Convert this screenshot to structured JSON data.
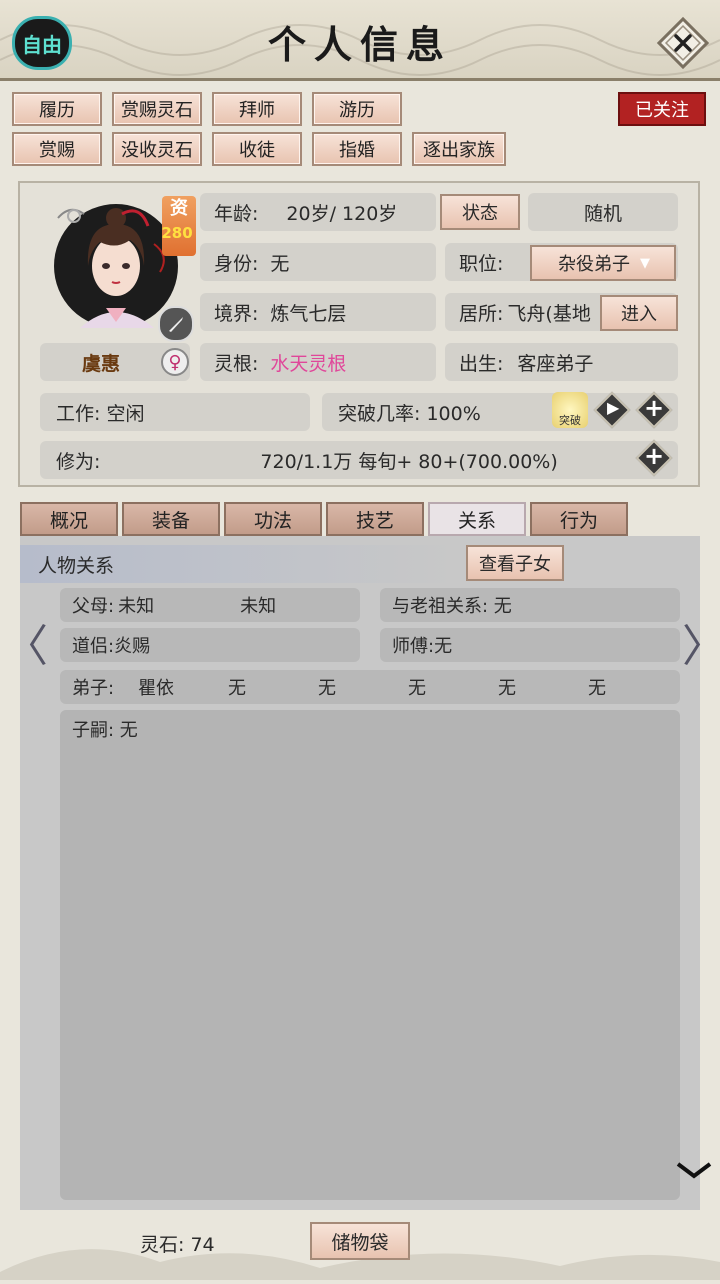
{
  "header": {
    "title": "个人信息",
    "free_label": "自由"
  },
  "actions": {
    "row1": [
      "履历",
      "赏赐灵石",
      "拜师",
      "游历"
    ],
    "row2": [
      "赏赐",
      "没收灵石",
      "收徒",
      "指婚",
      "逐出家族"
    ],
    "follow_label": "已关注"
  },
  "character": {
    "aptitude_label": "资",
    "aptitude_value": "280",
    "name": "虞惠",
    "age_label": "年龄:",
    "age_value": "20岁/ 120岁",
    "status_btn": "状态",
    "random_btn": "随机",
    "identity_label": "身份:",
    "identity_value": "无",
    "position_label": "职位:",
    "position_value": "杂役弟子",
    "realm_label": "境界:",
    "realm_value": "炼气七层",
    "residence_label": "居所:",
    "residence_value": "飞舟(基地",
    "enter_btn": "进入",
    "root_label": "灵根:",
    "root_value": "水天灵根",
    "root_color": "#e0479a",
    "birth_label": "出生:",
    "birth_value": "客座弟子",
    "work": "工作: 空闲",
    "breakthrough": "突破几率: 100%",
    "break_icon_label": "突破",
    "cultivation_label": "修为:",
    "cultivation_value": "720/1.1万  每旬+  80+(700.00%)"
  },
  "tabs": [
    "概况",
    "装备",
    "功法",
    "技艺",
    "关系",
    "行为"
  ],
  "active_tab": "关系",
  "relations": {
    "section_title": "人物关系",
    "view_children_btn": "查看子女",
    "parents_label": "父母:",
    "parent1": "未知",
    "parent2": "未知",
    "ancestor": "与老祖关系: 无",
    "partner": "道侣:炎赐",
    "master": "师傅:无",
    "disciples_label": "弟子:",
    "disciples": [
      "瞿依",
      "无",
      "无",
      "无",
      "无",
      "无"
    ],
    "heirs": "子嗣: 无"
  },
  "footer": {
    "spirit_stone": "灵石: 74",
    "bag_btn": "储物袋"
  }
}
